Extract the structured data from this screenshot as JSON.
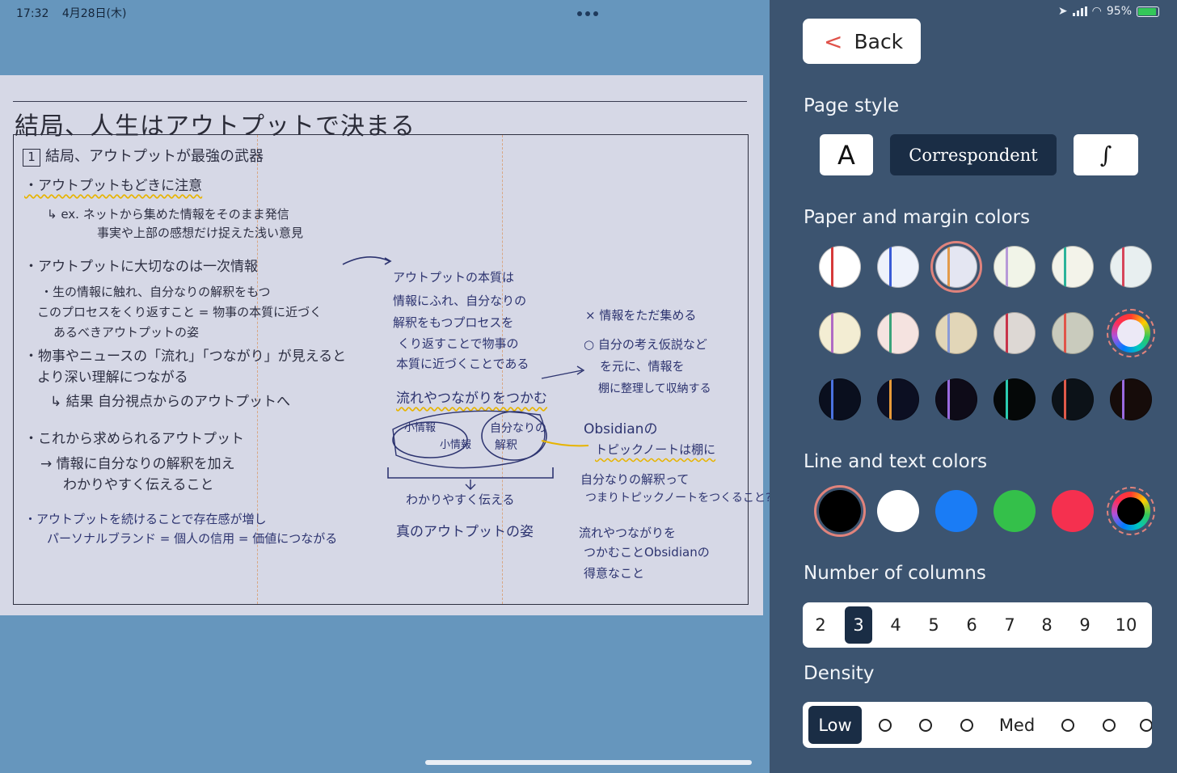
{
  "status_bar": {
    "time": "17:32",
    "date": "4月28日(木)",
    "battery": "95%"
  },
  "note": {
    "title": "結局、人生はアウトプットで決まる",
    "section_number": "1",
    "section_heading": "結局、アウトプットが最強の武器",
    "left_column": [
      {
        "text": "・アウトプットもどきに注意",
        "style": "underlined"
      },
      {
        "text": "↳ ex. ネットから集めた情報をそのまま発信"
      },
      {
        "text": "事実や上部の感想だけ捉えた浅い意見"
      },
      {
        "text": "・アウトプットに大切なのは一次情報"
      },
      {
        "text": "・生の情報に触れ、自分なりの解釈をもつ"
      },
      {
        "text": "このプロセスをくり返すこと = 物事の本質に近づく"
      },
      {
        "text": "あるべきアウトプットの姿"
      },
      {
        "text": "・物事やニュースの「流れ」「つながり」が見えると"
      },
      {
        "text": "より深い理解につながる"
      },
      {
        "text": "↳ 結果 自分視点からのアウトプットへ"
      },
      {
        "text": "・これから求められるアウトプット"
      },
      {
        "text": "→ 情報に自分なりの解釈を加え"
      },
      {
        "text": "わかりやすく伝えること"
      },
      {
        "text": "・アウトプットを続けることで存在感が増し",
        "style": "blue"
      },
      {
        "text": "パーソナルブランド = 個人の信用 = 価値につながる",
        "style": "blue"
      }
    ],
    "middle_column": [
      {
        "text": "アウトプットの本質は"
      },
      {
        "text": "情報にふれ、自分なりの"
      },
      {
        "text": "解釈をもつプロセスを"
      },
      {
        "text": "くり返すことで物事の"
      },
      {
        "text": "本質に近づくことである"
      },
      {
        "text": "流れやつながりをつかむ",
        "style": "underlined"
      },
      {
        "text": "小情報"
      },
      {
        "text": "小情報"
      },
      {
        "text": "自分なりの"
      },
      {
        "text": "解釈"
      },
      {
        "text": "わかりやすく伝える"
      },
      {
        "text": "真のアウトプットの姿"
      }
    ],
    "right_column": [
      {
        "text": "× 情報をただ集める"
      },
      {
        "text": "○ 自分の考え仮説など"
      },
      {
        "text": "を元に、情報を"
      },
      {
        "text": "棚に整理して収納する"
      },
      {
        "text": "Obsidianの"
      },
      {
        "text": "トピックノートは棚に",
        "style": "underlined"
      },
      {
        "text": "自分なりの解釈って"
      },
      {
        "text": "つまりトピックノートをつくること?"
      },
      {
        "text": "流れやつながりを"
      },
      {
        "text": "つかむことObsidianの"
      },
      {
        "text": "得意なこと"
      }
    ]
  },
  "panel": {
    "back_label": "Back",
    "page_style_label": "Page style",
    "page_styles": [
      "A",
      "Correspondent",
      "∫"
    ],
    "selected_page_style": "Correspondent",
    "paper_colors_label": "Paper and margin colors",
    "paper_swatches": [
      {
        "paper": "#ffffff",
        "margin": "#d63a3a"
      },
      {
        "paper": "#eef2fb",
        "margin": "#3a5bd6"
      },
      {
        "paper": "#e4e6f2",
        "margin": "#e39a4a",
        "selected": true
      },
      {
        "paper": "#f1f4e8",
        "margin": "#b79ad8"
      },
      {
        "paper": "#f3f3ea",
        "margin": "#2bb39a"
      },
      {
        "paper": "#e8eff0",
        "margin": "#d6455a"
      },
      {
        "paper": "#f3edd3",
        "margin": "#b06ac4"
      },
      {
        "paper": "#f5e3e0",
        "margin": "#3aa37a"
      },
      {
        "paper": "#e2d6b8",
        "margin": "#8a9bd8"
      },
      {
        "paper": "#ddd8d4",
        "margin": "#c8344a"
      },
      {
        "paper": "#c9cbbd",
        "margin": "#e0564a"
      },
      {
        "custom": true,
        "inner": "#ece9f6"
      },
      {
        "paper": "#0a0f1e",
        "margin": "#4a72e0"
      },
      {
        "paper": "#0c0f22",
        "margin": "#e89a38"
      },
      {
        "paper": "#0e0b18",
        "margin": "#9a6ae0"
      },
      {
        "paper": "#050808",
        "margin": "#2bcbb0"
      },
      {
        "paper": "#0c1218",
        "margin": "#e05a4a"
      },
      {
        "paper": "#160c0a",
        "margin": "#9a6ae0"
      }
    ],
    "line_colors_label": "Line and text colors",
    "line_colors": [
      {
        "color": "#000000",
        "selected": true
      },
      {
        "color": "#ffffff"
      },
      {
        "color": "#1a7cf5"
      },
      {
        "color": "#34c04a"
      },
      {
        "color": "#f5304f"
      },
      {
        "custom": true,
        "inner": "#000000"
      }
    ],
    "columns_label": "Number of columns",
    "columns": [
      "2",
      "3",
      "4",
      "5",
      "6",
      "7",
      "8",
      "9",
      "10"
    ],
    "selected_columns": "3",
    "density_label": "Density",
    "density_options": [
      "Low",
      "○",
      "○",
      "○",
      "Med",
      "○",
      "○",
      "○"
    ],
    "selected_density": "Low"
  }
}
